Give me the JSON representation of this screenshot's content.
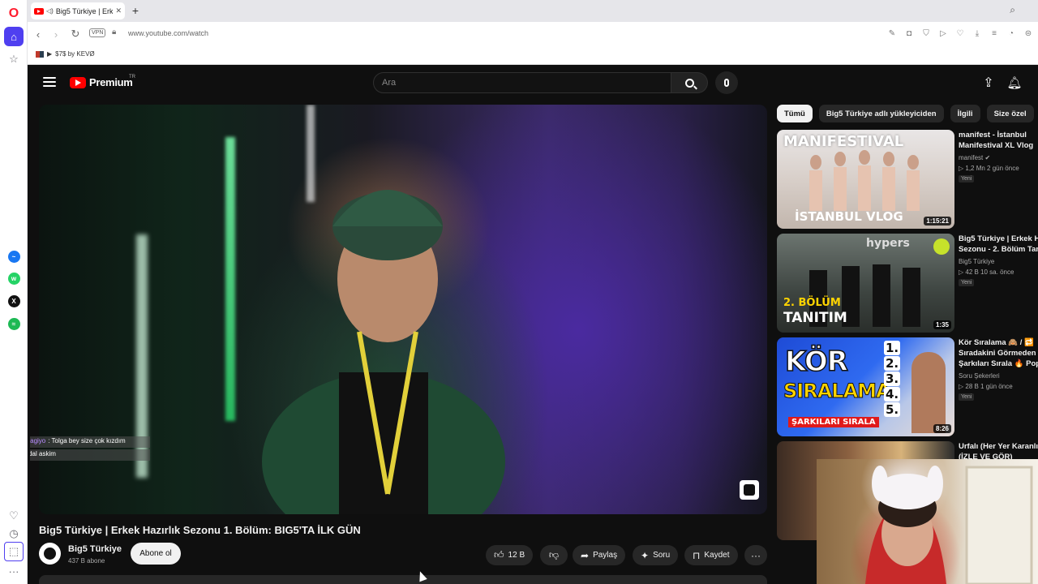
{
  "browser": {
    "tab": {
      "title": "Big5 Türkiye | Erkek H"
    },
    "address": {
      "vpn": "VPN",
      "url": "www.youtube.com/watch"
    },
    "bookmark": {
      "label": "$7$ by KEVØ"
    }
  },
  "youtube": {
    "logo_text": "Premium",
    "logo_region": "TR",
    "search_placeholder": "Ara",
    "video": {
      "title": "Big5 Türkiye | Erkek Hazırlık Sezonu 1. Bölüm: BIG5'TA İLK GÜN",
      "channel": "Big5 Türkiye",
      "subscribers": "437 B abone",
      "subscribe_label": "Abone ol",
      "likes": "12 B",
      "share_label": "Paylaş",
      "ask_label": "Soru",
      "save_label": "Kaydet"
    },
    "chips": [
      "Tümü",
      "Big5 Türkiye adlı yükleyiciden",
      "İlgili",
      "Size özel",
      "S"
    ],
    "recommendations": [
      {
        "title_line1": "manifest - İstanbul",
        "title_line2": "Manifestival XL Vlog",
        "channel": "manifest ✔",
        "meta": "▷ 1,2 Mn   2 gün önce",
        "badge": "Yeni",
        "duration": "1:15:21",
        "thumb_top": "MANIFESTIVAL",
        "thumb_bottom": "İSTANBUL VLOG"
      },
      {
        "title_line1": "Big5 Türkiye | Erkek Ha",
        "title_line2": "Sezonu - 2. Bölüm Tan",
        "channel": "Big5 Türkiye",
        "meta": "▷ 42 B   10 sa. önce",
        "badge": "Yeni",
        "duration": "1:35",
        "thumb_top": "hypers",
        "thumb_bottom1": "2. BÖLÜM",
        "thumb_bottom2": "TANITIM"
      },
      {
        "title_line1": "Kör Sıralama 🙈 / 🔁",
        "title_line2": "Sıradakini Görmeden",
        "title_line3": "Şarkıları Sırala 🔥 Popü",
        "channel": "Soru Şekerleri",
        "meta": "▷ 28 B   1 gün önce",
        "badge": "Yeni",
        "duration": "8:26",
        "thumb_big1": "KÖR",
        "thumb_big2": "SIRALAMA",
        "thumb_sub": "ŞARKILARI SIRALA",
        "numbers": [
          "1.",
          "2.",
          "3.",
          "4.",
          "5."
        ]
      },
      {
        "title_line1": "Urfalı  (Her Yer Karanlı",
        "title_line2": "(İZLE VE GÖR)"
      }
    ],
    "chat": [
      {
        "user": "yagmur_yagiyo",
        "text": ": Tolga bey size çok kızdım"
      },
      {
        "user": "offiaetk",
        "text": ": dal askim"
      }
    ]
  },
  "colors": {
    "opera_red": "#ff1b2d",
    "opera_accent": "#4f3ff0",
    "youtube_red": "#ff0000",
    "yt_bg": "#0f0f0f"
  }
}
